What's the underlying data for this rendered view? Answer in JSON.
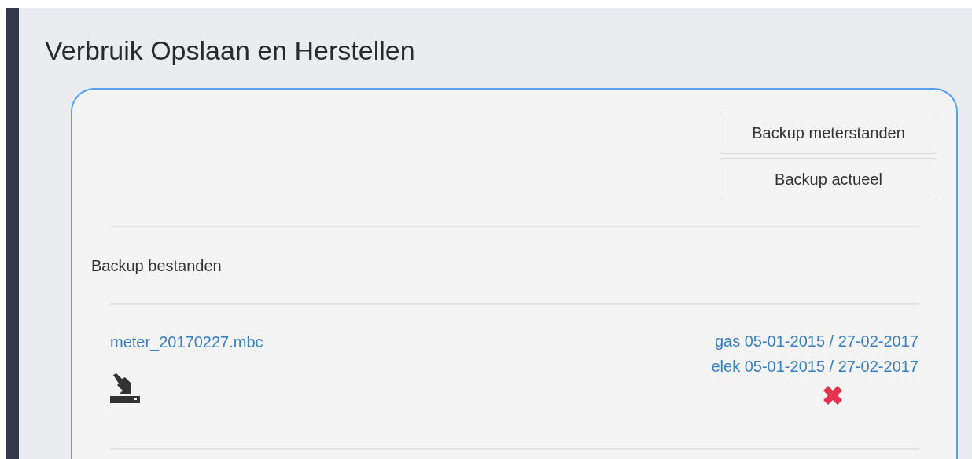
{
  "page": {
    "title": "Verbruik Opslaan en Herstellen"
  },
  "buttons": [
    "Backup meterstanden",
    "Backup actueel"
  ],
  "section_label": "Backup bestanden",
  "files": [
    {
      "name": "meter_20170227.mbc",
      "ranges": [
        "gas 05-01-2015 / 27-02-2017",
        "elek 05-01-2015 / 27-02-2017"
      ]
    }
  ]
}
